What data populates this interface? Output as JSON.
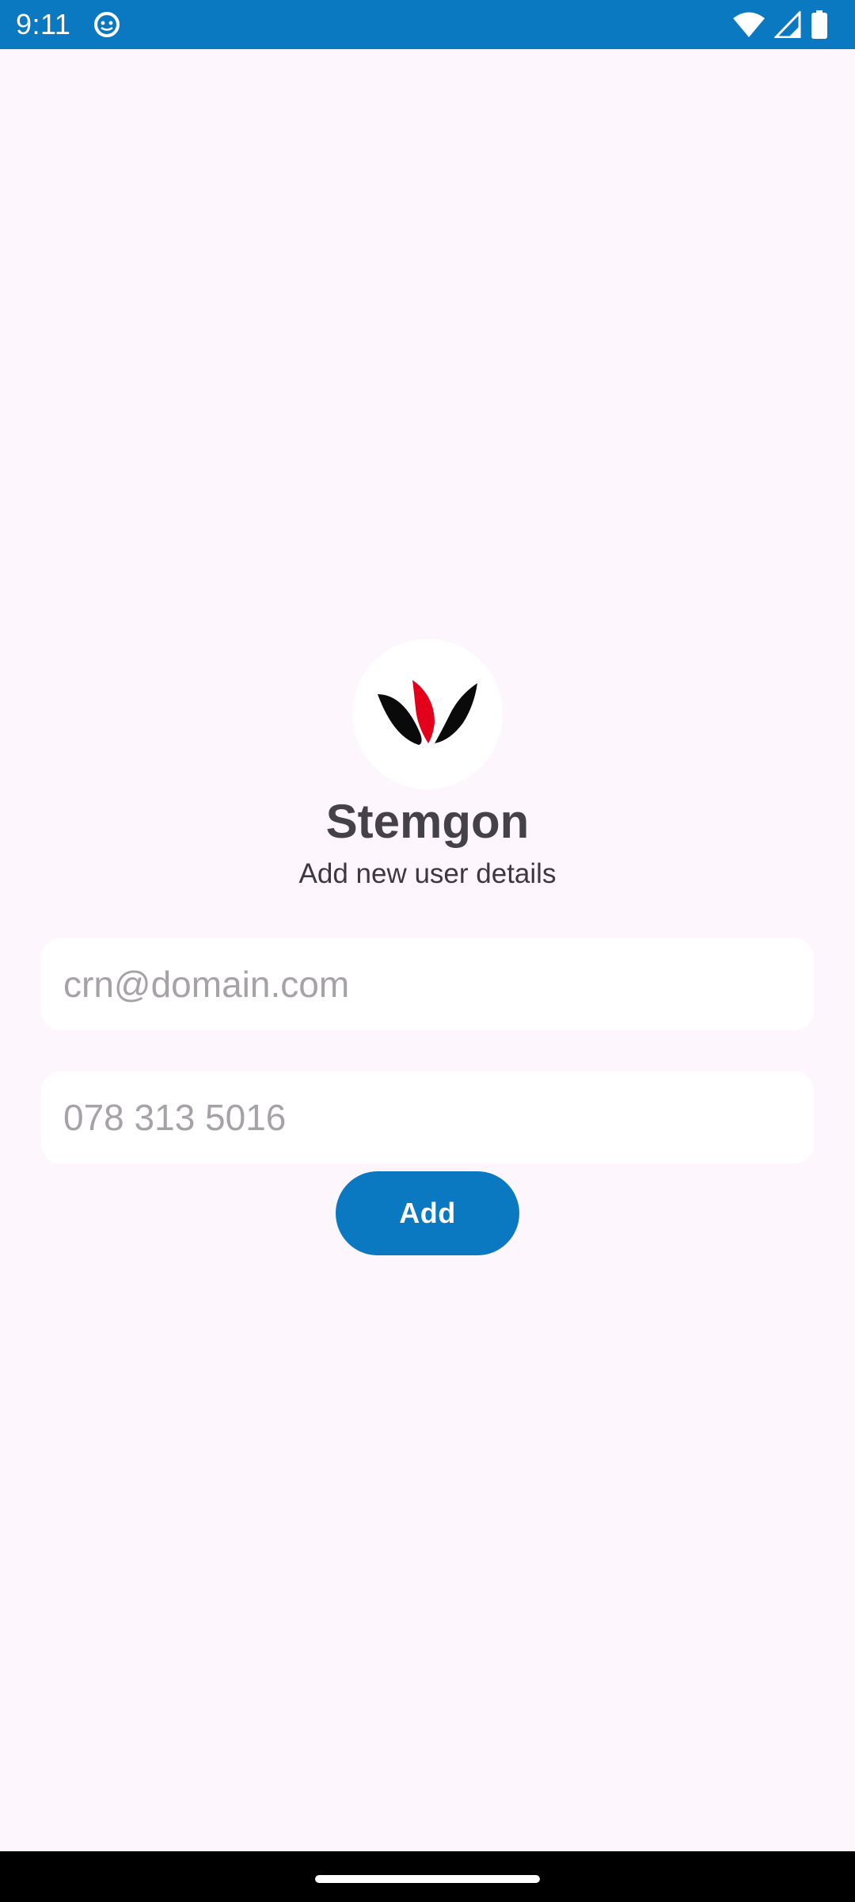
{
  "status_bar": {
    "time": "9:11",
    "background": "#0b78c2",
    "icons": [
      "app-notification-icon",
      "wifi-icon",
      "signal-icon",
      "battery-icon"
    ]
  },
  "app": {
    "logo": "stemgon-logo",
    "title": "Stemgon",
    "subtitle": "Add new user details"
  },
  "form": {
    "email": {
      "value": "",
      "placeholder": "crn@domain.com"
    },
    "phone": {
      "value": "",
      "placeholder": "078 313 5016"
    },
    "add_label": "Add"
  },
  "colors": {
    "accent": "#0b78c2",
    "background": "#fdf6fd",
    "logo_red": "#e3001b"
  }
}
